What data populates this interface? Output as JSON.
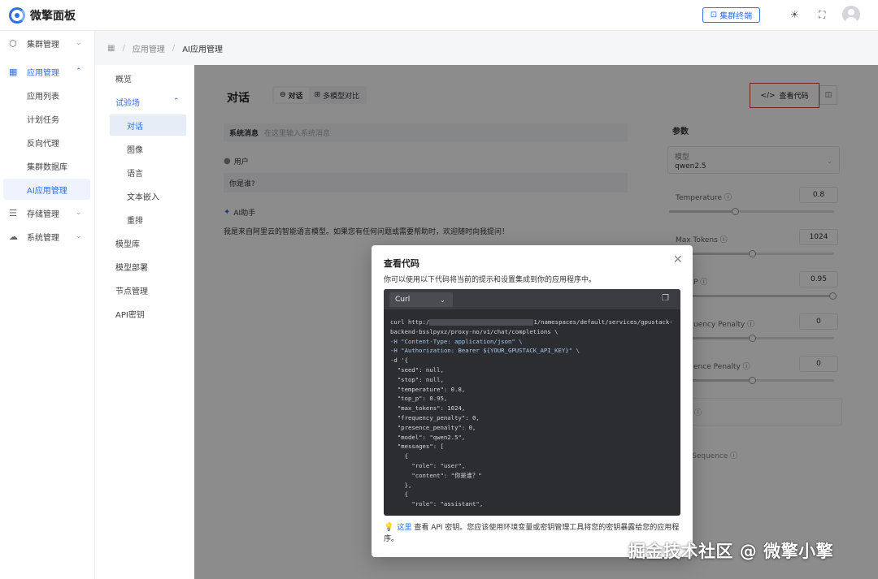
{
  "app": {
    "title": "微擎面板"
  },
  "topbar": {
    "cluster_terminal_label": "集群终端",
    "theme_icon": "sun-icon",
    "fullscreen_icon": "fullscreen-icon"
  },
  "leftnav": {
    "items": [
      {
        "label": "集群管理",
        "icon": "cube-icon"
      },
      {
        "label": "应用管理",
        "icon": "grid-icon"
      },
      {
        "label": "存储管理",
        "icon": "storage-icon"
      },
      {
        "label": "系统管理",
        "icon": "cloud-icon"
      }
    ],
    "app_subitems": [
      "应用列表",
      "计划任务",
      "反向代理",
      "集群数据库",
      "AI应用管理"
    ]
  },
  "breadcrumb": {
    "items": [
      "应用管理",
      "AI应用管理"
    ]
  },
  "submenu": {
    "overview": "概览",
    "playground": "试验场",
    "playground_items": [
      "对话",
      "图像",
      "语言",
      "文本嵌入",
      "重排"
    ],
    "others": [
      "模型库",
      "模型部署",
      "节点管理",
      "API密钥"
    ]
  },
  "main": {
    "title": "对话",
    "tabs": [
      {
        "label": "对话"
      },
      {
        "label": "多模型对比"
      }
    ],
    "view_code_label": "查看代码",
    "system_message_label": "系统消息",
    "system_message_placeholder": "在这里输入系统消息",
    "user_role": "用户",
    "user_message": "你是谁?",
    "ai_role": "AI助手",
    "ai_message": "我是来自阿里云的智能语言模型。如果您有任何问题或需要帮助时，欢迎随时向我提问！"
  },
  "params": {
    "title": "参数",
    "model_label": "模型",
    "model_value": "qwen2.5",
    "temperature": {
      "label": "Temperature",
      "value": "0.8",
      "level": 0.4
    },
    "max_tokens": {
      "label": "Max Tokens",
      "value": "1024",
      "level": 0.5
    },
    "top_p": {
      "label": "P",
      "value": "0.95",
      "level": 0.99
    },
    "frequency_penalty": {
      "label": "uency Penalty",
      "value": "0",
      "level": 0.5
    },
    "presence_penalty": {
      "label": "ence Penalty",
      "value": "0",
      "level": 0.5
    },
    "stop_sequence": "Sequence"
  },
  "modal": {
    "title": "查看代码",
    "description": "你可以使用以下代码将当前的提示和设置集成到你的应用程序中。",
    "language": "Curl",
    "code": {
      "l1_pre": "curl http:/",
      "l1_post": "1/namespaces/default/services/gpustack-",
      "l2": "backend-bsslpyxz/proxy-no/v1/chat/completions \\",
      "l3": "-H \"Content-Type: application/json\" \\",
      "l4": "-H \"Authorization: Bearer ${YOUR_GPUSTACK_API_KEY}\" \\",
      "l5": "-d '{",
      "l6": "  \"seed\": null,",
      "l7": "  \"stop\": null,",
      "l8": "  \"temperature\": 0.8,",
      "l9": "  \"top_p\": 0.95,",
      "l10": "  \"max_tokens\": 1024,",
      "l11": "  \"frequency_penalty\": 0,",
      "l12": "  \"presence_penalty\": 0,",
      "l13": "  \"model\": \"qwen2.5\",",
      "l14": "  \"messages\": [",
      "l15": "    {",
      "l16": "      \"role\": \"user\",",
      "l17": "      \"content\": \"你是谁？\"",
      "l18": "    },",
      "l19": "    {",
      "l20": "      \"role\": \"assistant\","
    },
    "footer_link": "这里",
    "footer_text": " 查看 API 密钥。您应该使用环境变量或密钥管理工具将您的密钥暴露给您的应用程序。"
  },
  "watermark": "掘金技术社区 @ 微擎小擎"
}
